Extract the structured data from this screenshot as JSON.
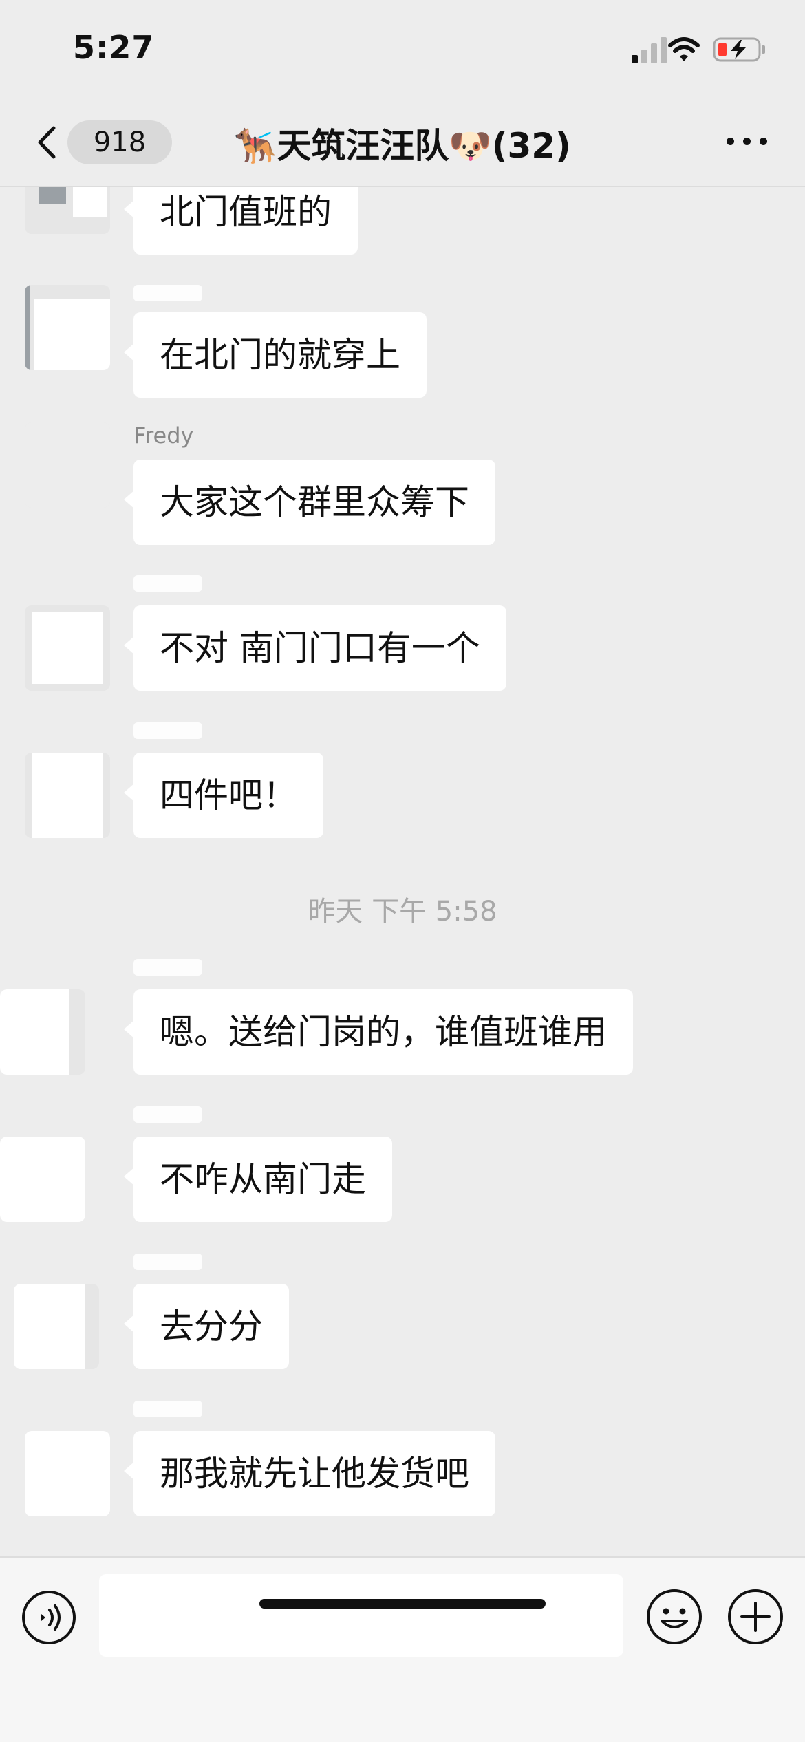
{
  "status_bar": {
    "time": "5:27"
  },
  "nav": {
    "unread_count": "918",
    "title": "🐕‍🦺天筑汪汪队🐶(32)"
  },
  "messages": [
    {
      "sender": "",
      "text": "北门值班的"
    },
    {
      "sender": "",
      "text": "在北门的就穿上"
    },
    {
      "sender": "Fredy",
      "text": "大家这个群里众筹下"
    },
    {
      "sender": "",
      "text": "不对 南门门口有一个"
    },
    {
      "sender": "",
      "text": "四件吧！"
    },
    {
      "sender": "",
      "text": "嗯。送给门岗的，谁值班谁用"
    },
    {
      "sender": "",
      "text": "不咋从南门走"
    },
    {
      "sender": "",
      "text": "去分分"
    },
    {
      "sender": "",
      "text": "那我就先让他发货吧"
    }
  ],
  "time_separator": "昨天 下午 5:58",
  "input_bar": {
    "placeholder": ""
  },
  "icons": {
    "back": "chevron-left-icon",
    "more": "ellipsis-icon",
    "voice": "voice-icon",
    "emoji": "smiley-icon",
    "plus": "plus-icon",
    "signal": "signal-icon",
    "wifi": "wifi-icon",
    "battery": "battery-charging-icon"
  },
  "colors": {
    "background": "#ededed",
    "bubble": "#ffffff",
    "battery_low": "#ff3b30"
  }
}
